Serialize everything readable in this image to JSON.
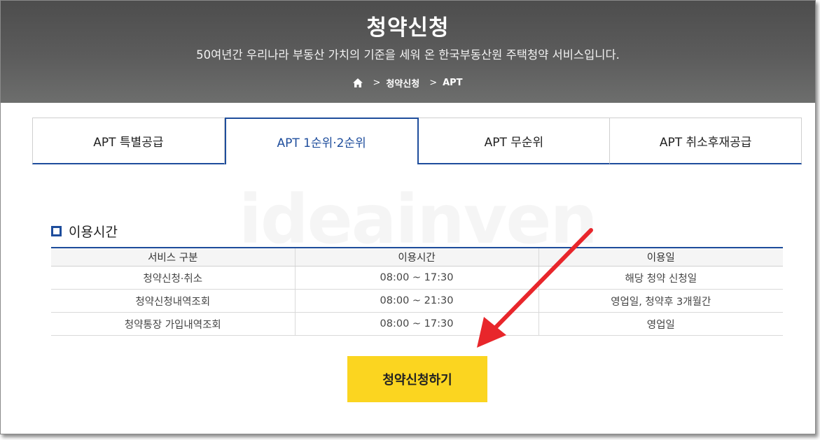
{
  "hero": {
    "title": "청약신청",
    "subtitle": "50여년간 우리나라 부동산 가치의 기준을 세워 온 한국부동산원 주택청약 서비스입니다.",
    "breadcrumb": [
      "청약신청",
      "APT"
    ],
    "background_color": "#5a5b5a"
  },
  "tabs": [
    {
      "label": "APT 특별공급",
      "active": false
    },
    {
      "label": "APT 1순위·2순위",
      "active": true
    },
    {
      "label": "APT 무순위",
      "active": false
    },
    {
      "label": "APT 취소후재공급",
      "active": false
    }
  ],
  "watermark": "ideainven",
  "usage_section": {
    "title": "이용시간",
    "columns": [
      "서비스 구분",
      "이용시간",
      "이용일"
    ],
    "rows": [
      [
        "청약신청·취소",
        "08:00 ~ 17:30",
        "해당 청약 신청일"
      ],
      [
        "청약신청내역조회",
        "08:00 ~ 21:30",
        "영업일, 청약후 3개월간"
      ],
      [
        "청약통장 가입내역조회",
        "08:00 ~ 17:30",
        "영업일"
      ]
    ]
  },
  "apply_button": {
    "label": "청약신청하기",
    "color": "#fbd520"
  },
  "colors": {
    "accent": "#1e4d9c",
    "annotation_arrow": "#e8262b"
  },
  "icons": {
    "home": "home-icon",
    "breadcrumb_separator": "chevron-right-icon",
    "section_bullet": "square-icon"
  }
}
